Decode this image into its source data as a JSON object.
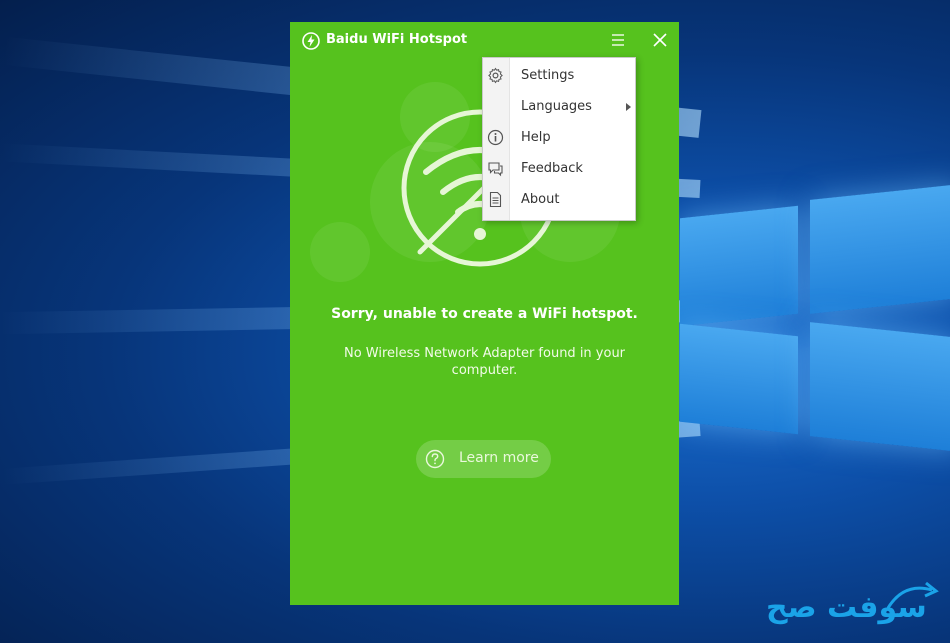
{
  "app": {
    "title": "Baidu WiFi Hotspot",
    "accent_color": "#56c21e"
  },
  "titlebar": {
    "menu_icon": "hamburger-menu-icon",
    "close_icon": "close-icon"
  },
  "status": {
    "headline": "Sorry, unable to create a WiFi hotspot.",
    "message": "No Wireless Network Adapter found in your computer."
  },
  "actions": {
    "learn_more_label": "Learn more",
    "learn_more_icon": "question-circle-icon"
  },
  "menu": {
    "items": [
      {
        "label": "Settings",
        "icon": "gear-icon"
      },
      {
        "label": "Languages",
        "icon": "",
        "has_submenu": true
      },
      {
        "label": "Help",
        "icon": "info-icon"
      },
      {
        "label": "Feedback",
        "icon": "feedback-icon"
      },
      {
        "label": "About",
        "icon": "document-icon"
      }
    ]
  },
  "watermark": {
    "text": "سوفت صح"
  }
}
